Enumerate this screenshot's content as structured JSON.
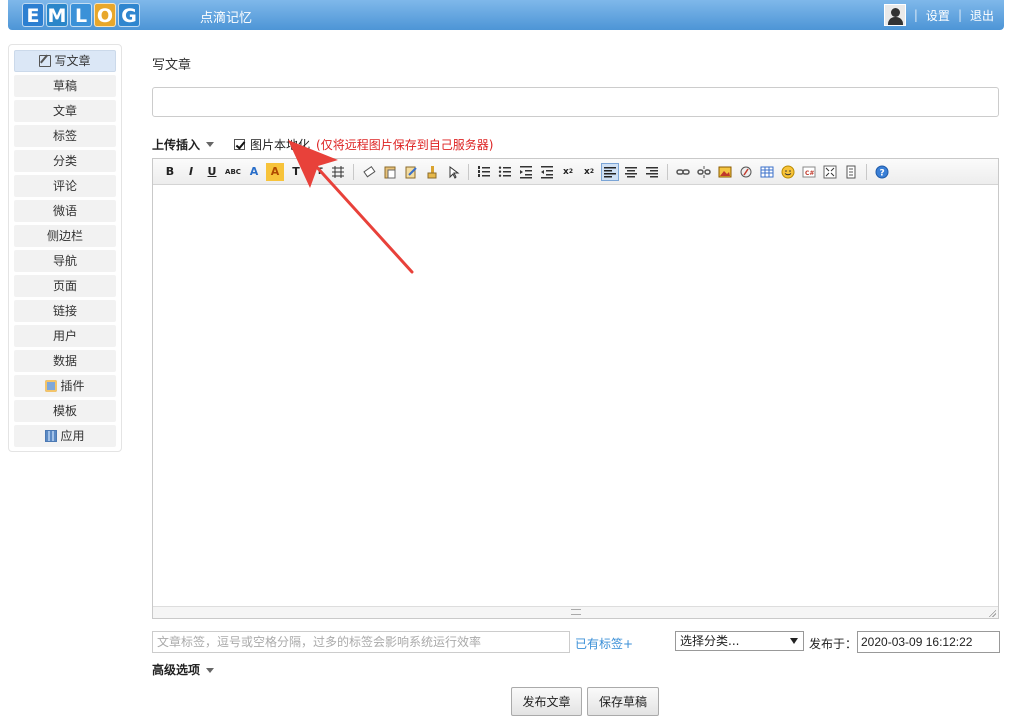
{
  "header": {
    "logo": [
      "E",
      "M",
      "L",
      "O",
      "G"
    ],
    "site_name": "点滴记忆",
    "separator": "|",
    "settings": "设置",
    "logout": "退出"
  },
  "sidebar": {
    "items": [
      {
        "label": "写文章",
        "icon": "pencil-icon",
        "active": true
      },
      {
        "label": "草稿"
      },
      {
        "label": "文章"
      },
      {
        "label": "标签"
      },
      {
        "label": "分类"
      },
      {
        "label": "评论"
      },
      {
        "label": "微语"
      },
      {
        "label": "侧边栏"
      },
      {
        "label": "导航"
      },
      {
        "label": "页面"
      },
      {
        "label": "链接"
      },
      {
        "label": "用户"
      },
      {
        "label": "数据"
      },
      {
        "label": "插件",
        "icon": "plugin-icon"
      },
      {
        "label": "模板"
      },
      {
        "label": "应用",
        "icon": "app-icon"
      }
    ]
  },
  "main": {
    "title": "写文章",
    "title_value": "",
    "upload_insert": "上传插入",
    "localize_label": "图片本地化",
    "localize_note": "(仅将远程图片保存到自己服务器)",
    "localize_checked": true
  },
  "toolbar": {
    "text_buttons": [
      "B",
      "I",
      "U",
      "ABC",
      "A",
      "A",
      "T",
      "тT"
    ]
  },
  "footer": {
    "tags_placeholder": "文章标签，逗号或空格分隔，过多的标签会影响系统运行效率",
    "existing_tags": "已有标签+",
    "category_selected": "选择分类...",
    "publish_time_label": "发布于：",
    "publish_time_value": "2020-03-09 16:12:22",
    "advanced_options": "高级选项",
    "publish_button": "发布文章",
    "save_draft_button": "保存草稿"
  },
  "colors": {
    "header_blue": "#4d95d6",
    "note_red": "#dd2222",
    "link_blue": "#3a8fd7",
    "arrow_red": "#e8413a"
  }
}
